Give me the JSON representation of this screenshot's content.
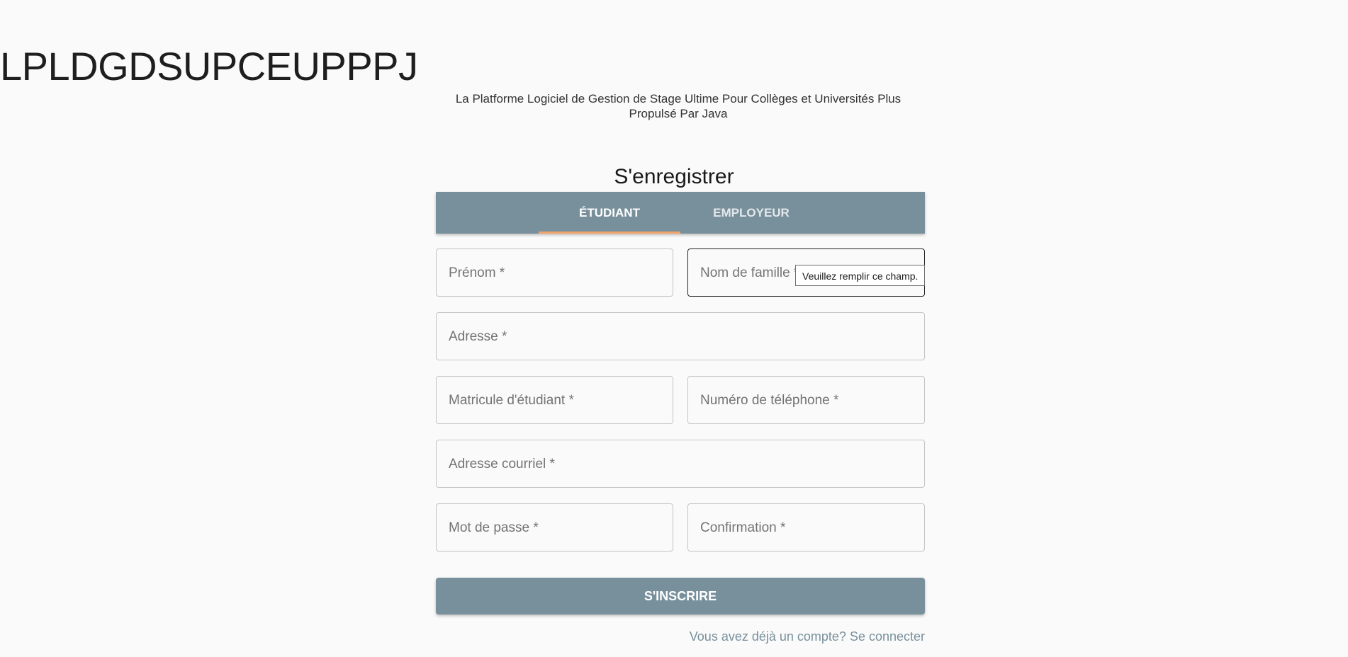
{
  "header": {
    "title": "LPLDGDSUPCEUPPPJ",
    "subtitle": "La Platforme Logiciel de Gestion de Stage Ultime Pour Collèges et Universités Plus Propulsé Par Java"
  },
  "form": {
    "title": "S'enregistrer",
    "tabs": [
      {
        "label": "ÉTUDIANT",
        "active": true
      },
      {
        "label": "EMPLOYEUR",
        "active": false
      }
    ],
    "fields": {
      "first_name": {
        "label": "Prénom *",
        "value": ""
      },
      "last_name": {
        "label": "Nom de famille *",
        "value": ""
      },
      "address": {
        "label": "Adresse *",
        "value": ""
      },
      "student_id": {
        "label": "Matricule d'étudiant *",
        "value": ""
      },
      "phone": {
        "label": "Numéro de téléphone *",
        "value": ""
      },
      "email": {
        "label": "Adresse courriel *",
        "value": ""
      },
      "password": {
        "label": "Mot de passe *",
        "value": ""
      },
      "confirm": {
        "label": "Confirmation *",
        "value": ""
      }
    },
    "validation_tooltip": "Veuillez remplir ce champ.",
    "submit_label": "S'INSCRIRE",
    "login_link": "Vous avez déjà un compte? Se connecter"
  },
  "colors": {
    "primary": "#78909c",
    "tab_indicator": "#f2a36b",
    "background": "#fafafa"
  }
}
